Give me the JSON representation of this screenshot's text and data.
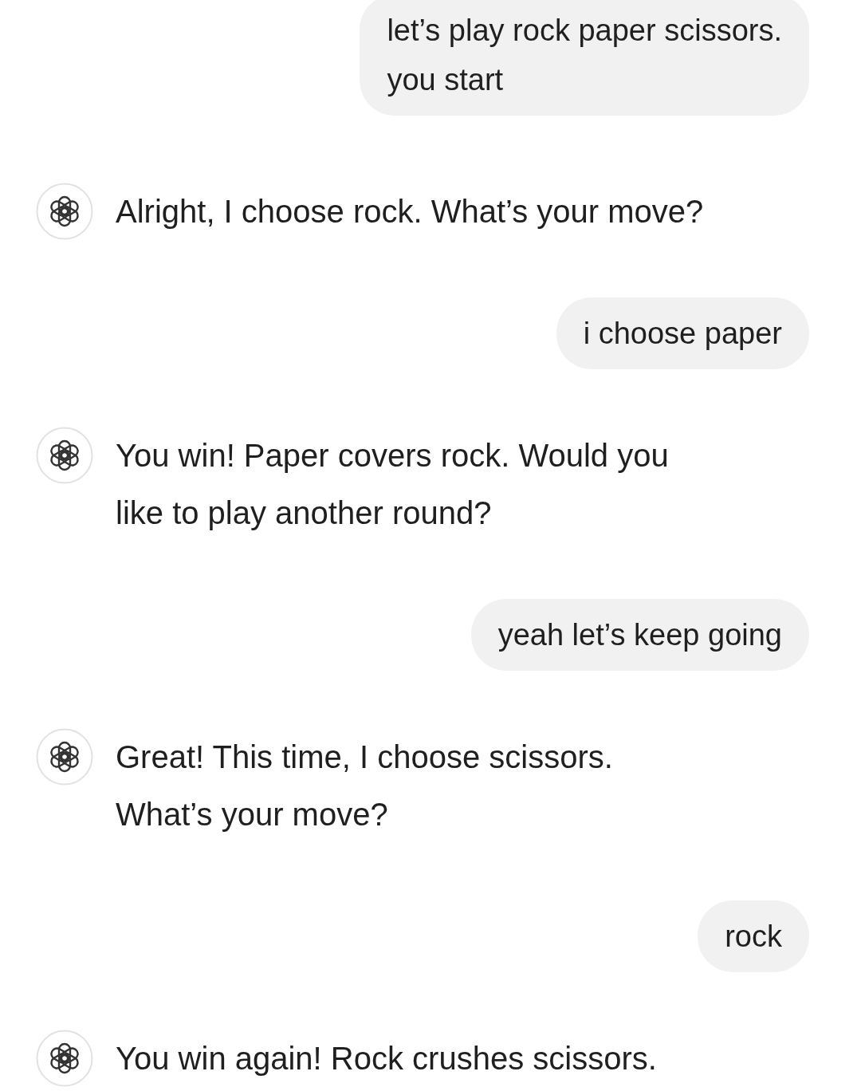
{
  "messages": [
    {
      "kind": "user",
      "text": "let’s play rock paper scissors.\nyou start"
    },
    {
      "kind": "assistant",
      "text": "Alright, I choose rock. What’s your move?"
    },
    {
      "kind": "user",
      "text": "i choose paper"
    },
    {
      "kind": "assistant",
      "text": "You win! Paper covers rock. Would you\nlike to play another round?"
    },
    {
      "kind": "user",
      "text": "yeah let’s keep going"
    },
    {
      "kind": "assistant",
      "text": "Great! This time, I choose scissors.\nWhat’s your move?"
    },
    {
      "kind": "user",
      "text": "rock"
    },
    {
      "kind": "assistant",
      "text": "You win again! Rock crushes scissors."
    }
  ]
}
